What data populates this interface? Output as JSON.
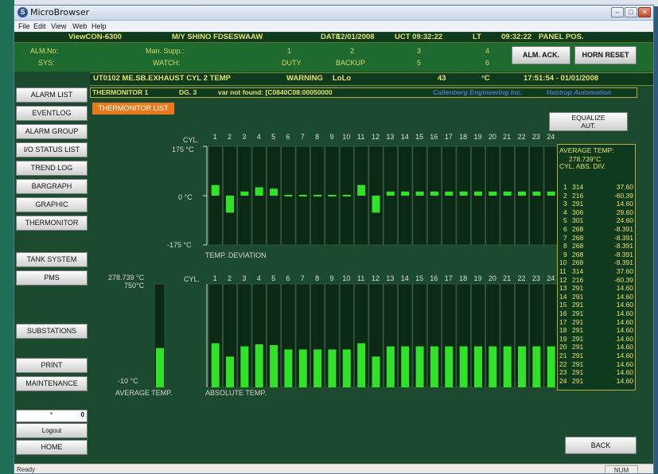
{
  "window": {
    "title": "MicroBrowser"
  },
  "menu": [
    "File",
    "Edit",
    "View",
    "Web",
    "Help"
  ],
  "header": {
    "system": "ViewCON-6300",
    "vessel": "M/Y SHINO FDSESWAAW",
    "date_label": "DATE",
    "date": "12/01/2008",
    "uct": "UCT 09:32:22",
    "lt_label": "LT",
    "lt": "09:32:22",
    "panel": "PANEL POS."
  },
  "status_row": {
    "alm_no": "ALM.No:",
    "sys": "SYS:",
    "man_supp": "Man. Supp.:",
    "watch": "WATCH:",
    "duty": "DUTY",
    "backup": "BACKUP",
    "n1": "1",
    "n2": "2",
    "n3": "3",
    "n4": "4",
    "n5": "5",
    "n6": "6"
  },
  "buttons": {
    "alm_ack": "ALM. ACK.",
    "horn_reset": "HORN RESET",
    "equalize_1": "EQUALIZE",
    "equalize_2": "AUT.",
    "back": "BACK"
  },
  "alarm": {
    "tag": "UT0102 ME.SB.EXHAUST CYL 2 TEMP",
    "level": "WARNING",
    "type": "LoLo",
    "value": "43",
    "unit": "°C",
    "time": "17:51:54 - 01/01/2008"
  },
  "info": {
    "screen": "THERMONITOR 1",
    "dg": "DG. 3",
    "msg": "var not found: [C0840C08:00050000",
    "brand1": "Callenberg Engineering Inc.",
    "brand2": "Hastrup Automation"
  },
  "nav": [
    "ALARM LIST",
    "EVENTLOG",
    "ALARM GROUP",
    "I/O STATUS LIST",
    "TREND LOG",
    "BARGRAPH",
    "GRAPHIC",
    "THERMONITOR",
    "TANK SYSTEM",
    "PMS",
    "SUBSTATIONS",
    "PRINT",
    "MAINTENANCE",
    "Logout",
    "HOME"
  ],
  "login_box": {
    "mark": "*",
    "value": "0"
  },
  "active_tab": "THERMONITOR LIST",
  "chart_data": [
    {
      "type": "bar",
      "title": "",
      "xlabel": "TEMP. DEVIATION",
      "ylabel": "",
      "axis_prefix": "CYL.",
      "ylim": [
        -175,
        175
      ],
      "ytick_labels": [
        "175 °C",
        "0 °C",
        "-175 °C"
      ],
      "categories": [
        "1",
        "2",
        "3",
        "4",
        "5",
        "6",
        "7",
        "8",
        "9",
        "10",
        "11",
        "12",
        "13",
        "14",
        "15",
        "16",
        "17",
        "18",
        "19",
        "20",
        "21",
        "22",
        "23",
        "24"
      ],
      "values": [
        37.6,
        -60.39,
        14.6,
        29.6,
        24.6,
        -8.391,
        -8.391,
        -8.391,
        -8.391,
        -8.391,
        37.6,
        -60.39,
        14.6,
        14.6,
        14.6,
        14.6,
        14.6,
        14.6,
        14.6,
        14.6,
        14.6,
        14.6,
        14.6,
        14.6
      ],
      "color": "#33e02c"
    },
    {
      "type": "bar",
      "title": "",
      "xlabel": "ABSOLUTE TEMP.",
      "ylabel": "",
      "axis_prefix": "CYL.",
      "ylim": [
        -10,
        750
      ],
      "categories": [
        "1",
        "2",
        "3",
        "4",
        "5",
        "6",
        "7",
        "8",
        "9",
        "10",
        "11",
        "12",
        "13",
        "14",
        "15",
        "16",
        "17",
        "18",
        "19",
        "20",
        "21",
        "22",
        "23",
        "24"
      ],
      "values": [
        314,
        216,
        291,
        306,
        301,
        268,
        268,
        268,
        268,
        268,
        314,
        216,
        291,
        291,
        291,
        291,
        291,
        291,
        291,
        291,
        291,
        291,
        291,
        291
      ],
      "color": "#33e02c"
    },
    {
      "type": "bar",
      "title": "",
      "xlabel": "AVERAGE TEMP.",
      "ylim": [
        -10,
        750
      ],
      "ytick_labels": [
        "750°C",
        "-10 °C"
      ],
      "value_label": "278.739 °C",
      "values": [
        278.739
      ],
      "color": "#33e02c"
    }
  ],
  "avg_table": {
    "title": "AVERAGE TEMP:",
    "value": "278.739°C",
    "columns": "CYL. ABS.  DIV.",
    "rows": [
      {
        "cyl": "1",
        "abs": "314",
        "div": "37.60"
      },
      {
        "cyl": "2",
        "abs": "216",
        "div": "-60.39"
      },
      {
        "cyl": "3",
        "abs": "291",
        "div": "14.60"
      },
      {
        "cyl": "4",
        "abs": "306",
        "div": "29.60"
      },
      {
        "cyl": "5",
        "abs": "301",
        "div": "24.60"
      },
      {
        "cyl": "6",
        "abs": "268",
        "div": "-8.391"
      },
      {
        "cyl": "7",
        "abs": "268",
        "div": "-8.391"
      },
      {
        "cyl": "8",
        "abs": "268",
        "div": "-8.391"
      },
      {
        "cyl": "9",
        "abs": "268",
        "div": "-8.391"
      },
      {
        "cyl": "10",
        "abs": "268",
        "div": "-8.391"
      },
      {
        "cyl": "11",
        "abs": "314",
        "div": "37.60"
      },
      {
        "cyl": "12",
        "abs": "216",
        "div": "-60.39"
      },
      {
        "cyl": "13",
        "abs": "291",
        "div": "14.60"
      },
      {
        "cyl": "14",
        "abs": "291",
        "div": "14.60"
      },
      {
        "cyl": "15",
        "abs": "291",
        "div": "14.60"
      },
      {
        "cyl": "16",
        "abs": "291",
        "div": "14.60"
      },
      {
        "cyl": "17",
        "abs": "291",
        "div": "14.60"
      },
      {
        "cyl": "18",
        "abs": "291",
        "div": "14.60"
      },
      {
        "cyl": "19",
        "abs": "291",
        "div": "14.60"
      },
      {
        "cyl": "20",
        "abs": "291",
        "div": "14.60"
      },
      {
        "cyl": "21",
        "abs": "291",
        "div": "14.60"
      },
      {
        "cyl": "22",
        "abs": "291",
        "div": "14.60"
      },
      {
        "cyl": "23",
        "abs": "291",
        "div": "14.60"
      },
      {
        "cyl": "24",
        "abs": "291",
        "div": "14.60"
      }
    ]
  },
  "statusbar": {
    "left": "Ready",
    "num": "NUM"
  },
  "colors": {
    "bg": "#1b4a2e",
    "bar": "#33e02c",
    "accent": "#e8791c",
    "text_yellow": "#e6e26e"
  }
}
